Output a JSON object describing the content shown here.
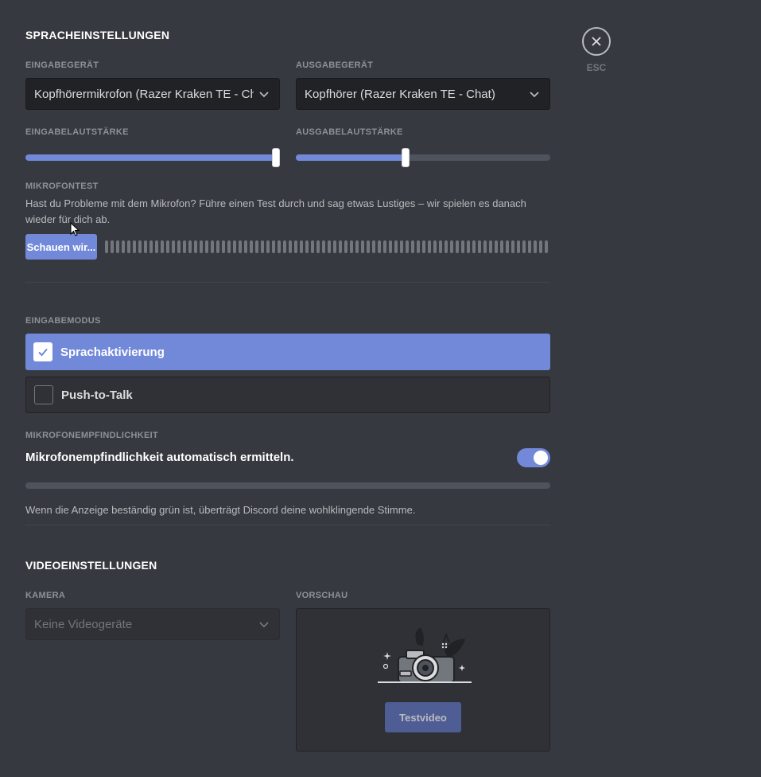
{
  "voice": {
    "heading": "SPRACHEINSTELLUNGEN",
    "input_device_label": "EINGABEGERÄT",
    "input_device_value": "Kopfhörermikrofon (Razer Kraken TE - Chat)",
    "output_device_label": "AUSGABEGERÄT",
    "output_device_value": "Kopfhörer (Razer Kraken TE - Chat)",
    "input_volume_label": "EINGABELAUTSTÄRKE",
    "input_volume_percent": 100,
    "output_volume_label": "AUSGABELAUTSTÄRKE",
    "output_volume_percent": 43,
    "mic_test_label": "MIKROFONTEST",
    "mic_test_description": "Hast du Probleme mit dem Mikrofon? Führe einen Test durch und sag etwas Lustiges – wir spielen es danach wieder für dich ab.",
    "mic_test_button": "Schauen wir...",
    "input_mode_label": "EINGABEMODUS",
    "input_mode_options": [
      {
        "label": "Sprachaktivierung",
        "selected": true
      },
      {
        "label": "Push-to-Talk",
        "selected": false
      }
    ],
    "sensitivity_label": "MIKROFONEMPFINDLICHKEIT",
    "sensitivity_auto_label": "Mikrofonempfindlichkeit automatisch ermitteln.",
    "sensitivity_auto_enabled": true,
    "sensitivity_hint": "Wenn die Anzeige beständig grün ist, überträgt Discord deine wohlklingende Stimme."
  },
  "video": {
    "heading": "VIDEOEINSTELLUNGEN",
    "camera_label": "KAMERA",
    "camera_value": "Keine Videogeräte",
    "preview_label": "VORSCHAU",
    "test_video_button": "Testvideo"
  },
  "close": {
    "icon": "close-icon",
    "label": "ESC"
  },
  "colors": {
    "background": "#36393f",
    "accent": "#7289da",
    "input_bg": "#202225"
  }
}
